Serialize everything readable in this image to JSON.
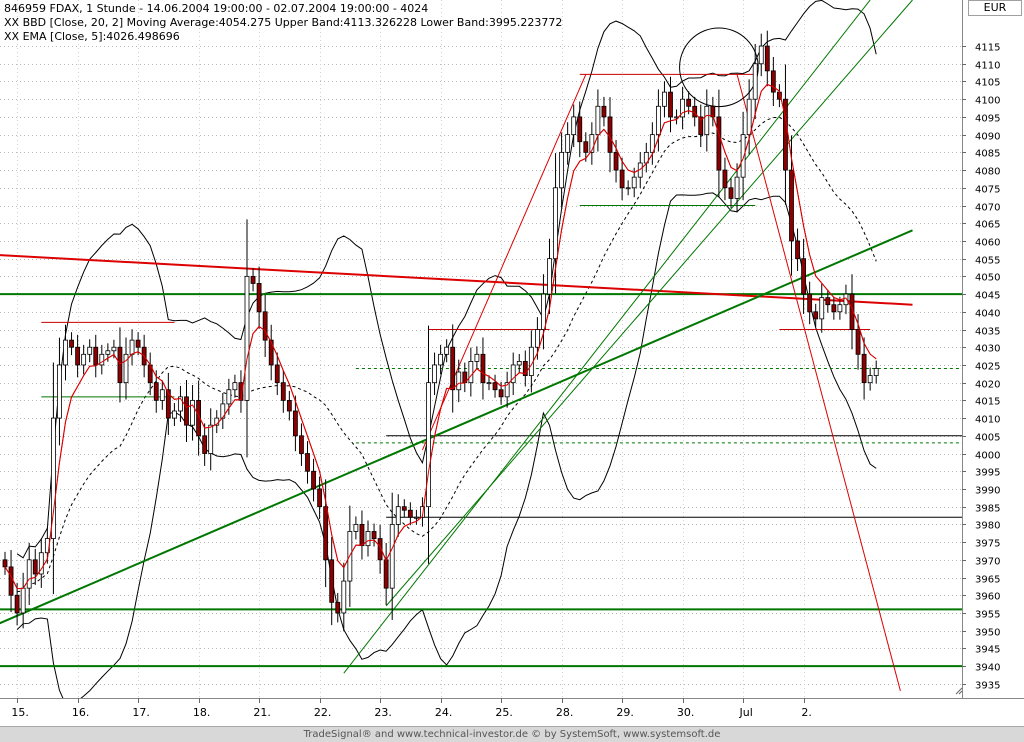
{
  "chart_data": {
    "type": "candlestick",
    "legend": [
      {
        "text": "846959  FDAX, 1 Stunde - 14.06.2004 19:00:00 - 02.07.2004 19:00:00 - 4024",
        "color": "#000000"
      },
      {
        "text": "XX BBD [Close, 20, 2] Moving Average:4054.275 Upper Band:4113.326228 Lower Band:3995.223772",
        "color": "#000000"
      },
      {
        "text": "XX EMA [Close, 5]:4026.498696",
        "color": "#cc0000"
      }
    ],
    "currency": "EUR",
    "ylim": [
      3931,
      4128
    ],
    "yticks": [
      3935,
      3940,
      3945,
      3950,
      3955,
      3960,
      3965,
      3970,
      3975,
      3980,
      3985,
      3990,
      3995,
      4000,
      4005,
      4010,
      4015,
      4020,
      4025,
      4030,
      4035,
      4040,
      4045,
      4050,
      4055,
      4060,
      4065,
      4070,
      4075,
      4080,
      4085,
      4090,
      4095,
      4100,
      4105,
      4110,
      4115
    ],
    "xlabels": [
      {
        "label": "15.",
        "bar": 2.5
      },
      {
        "label": "16.",
        "bar": 12.5
      },
      {
        "label": "17.",
        "bar": 22.5
      },
      {
        "label": "18.",
        "bar": 32.5
      },
      {
        "label": "21.",
        "bar": 42.5
      },
      {
        "label": "22.",
        "bar": 52.5
      },
      {
        "label": "23.",
        "bar": 62.5
      },
      {
        "label": "24.",
        "bar": 72.5
      },
      {
        "label": "25.",
        "bar": 82.5
      },
      {
        "label": "28.",
        "bar": 92.5
      },
      {
        "label": "29.",
        "bar": 102.5
      },
      {
        "label": "30.",
        "bar": 112.5
      },
      {
        "label": "Jul",
        "bar": 122.5
      },
      {
        "label": "2.",
        "bar": 132.5
      }
    ],
    "close": [
      3968,
      3960,
      3955,
      3962,
      3970,
      3966,
      3972,
      3976,
      4010,
      4025,
      4032,
      4030,
      4025,
      4028,
      4030,
      4025,
      4028,
      4029,
      4030,
      4020,
      4028,
      4032,
      4030,
      4025,
      4020,
      4015,
      4018,
      4010,
      4012,
      4016,
      4008,
      4015,
      4005,
      4000,
      4008,
      4010,
      4014,
      4018,
      4020,
      4015,
      4050,
      4048,
      4040,
      4032,
      4025,
      4020,
      4015,
      4012,
      4005,
      4000,
      3995,
      3990,
      3985,
      3970,
      3958,
      3955,
      3964,
      3978,
      3980,
      3974,
      3978,
      3976,
      3970,
      3962,
      3980,
      3985,
      3984,
      3982,
      3982,
      3985,
      4020,
      4025,
      4028,
      4030,
      4018,
      4023,
      4020,
      4026,
      4028,
      4020,
      4020,
      4018,
      4016,
      4020,
      4025,
      4026,
      4022,
      4030,
      4035,
      4045,
      4055,
      4075,
      4085,
      4090,
      4095,
      4088,
      4085,
      4090,
      4098,
      4095,
      4085,
      4080,
      4075,
      4075,
      4078,
      4082,
      4085,
      4090,
      4098,
      4102,
      4095,
      4095,
      4100,
      4098,
      4095,
      4090,
      4098,
      4095,
      4080,
      4075,
      4072,
      4078,
      4090,
      4100,
      4110,
      4115,
      4108,
      4102,
      4100,
      4080,
      4060,
      4055,
      4045,
      4040,
      4038,
      4044,
      4042,
      4040,
      4042,
      4045,
      4035,
      4028,
      4020,
      4022,
      4024
    ],
    "ema5_last": 4026.498696,
    "bollinger": {
      "period": 20,
      "stddev": 2,
      "moving_average": 4054.275,
      "upper_band": 4113.326228,
      "lower_band": 3995.223772
    },
    "annotations": {
      "horizontal_lines": [
        {
          "value": 4045,
          "color": "#007700",
          "style": "solid",
          "width": 2
        },
        {
          "value": 3956,
          "color": "#007700",
          "style": "solid",
          "width": 2
        },
        {
          "value": 3940,
          "color": "#007700",
          "style": "solid",
          "width": 2
        },
        {
          "value": 4024,
          "color": "#007700",
          "style": "dashed",
          "from_bar": 58
        },
        {
          "value": 4003,
          "color": "#007700",
          "style": "dashed",
          "from_bar": 58
        },
        {
          "value": 4005,
          "color": "#000000",
          "style": "solid",
          "from_bar": 63
        },
        {
          "value": 3982,
          "color": "#000000",
          "style": "solid",
          "from_bar": 63
        },
        {
          "value": 4037,
          "color": "#cc0000",
          "style": "solid",
          "from_bar": 6,
          "to_bar": 28
        },
        {
          "value": 4035,
          "color": "#cc0000",
          "style": "solid",
          "from_bar": 70,
          "to_bar": 90
        },
        {
          "value": 4107,
          "color": "#cc0000",
          "style": "solid",
          "from_bar": 95,
          "to_bar": 124
        },
        {
          "value": 4035,
          "color": "#cc0000",
          "style": "solid",
          "from_bar": 128,
          "to_bar": 143
        },
        {
          "value": 4016,
          "color": "#007700",
          "style": "solid",
          "from_bar": 6,
          "to_bar": 28
        },
        {
          "value": 4070,
          "color": "#007700",
          "style": "solid",
          "from_bar": 95,
          "to_bar": 124
        }
      ],
      "trend_lines": [
        {
          "from": [
            -1,
            4056
          ],
          "to": [
            150,
            4042
          ],
          "color": "#dd0000",
          "width": 2
        },
        {
          "from": [
            -1,
            3952
          ],
          "to": [
            150,
            4063
          ],
          "color": "#007700",
          "width": 2
        },
        {
          "from": [
            56,
            3938
          ],
          "to": [
            143,
            4128
          ],
          "color": "#007700",
          "width": 1
        },
        {
          "from": [
            63,
            3957
          ],
          "to": [
            150,
            4128
          ],
          "color": "#007700",
          "width": 1
        },
        {
          "from": [
            69,
            4001
          ],
          "to": [
            96,
            4107
          ],
          "color": "#dd0000",
          "width": 1
        },
        {
          "from": [
            121,
            4107
          ],
          "to": [
            148,
            3933
          ],
          "color": "#dd0000",
          "width": 1
        }
      ],
      "circle": {
        "bar": 118,
        "value": 4109,
        "radius_bars": 6.5
      }
    }
  },
  "footer": "TradeSignal® and www.technical-investor.de © by SystemSoft, www.systemsoft.de"
}
